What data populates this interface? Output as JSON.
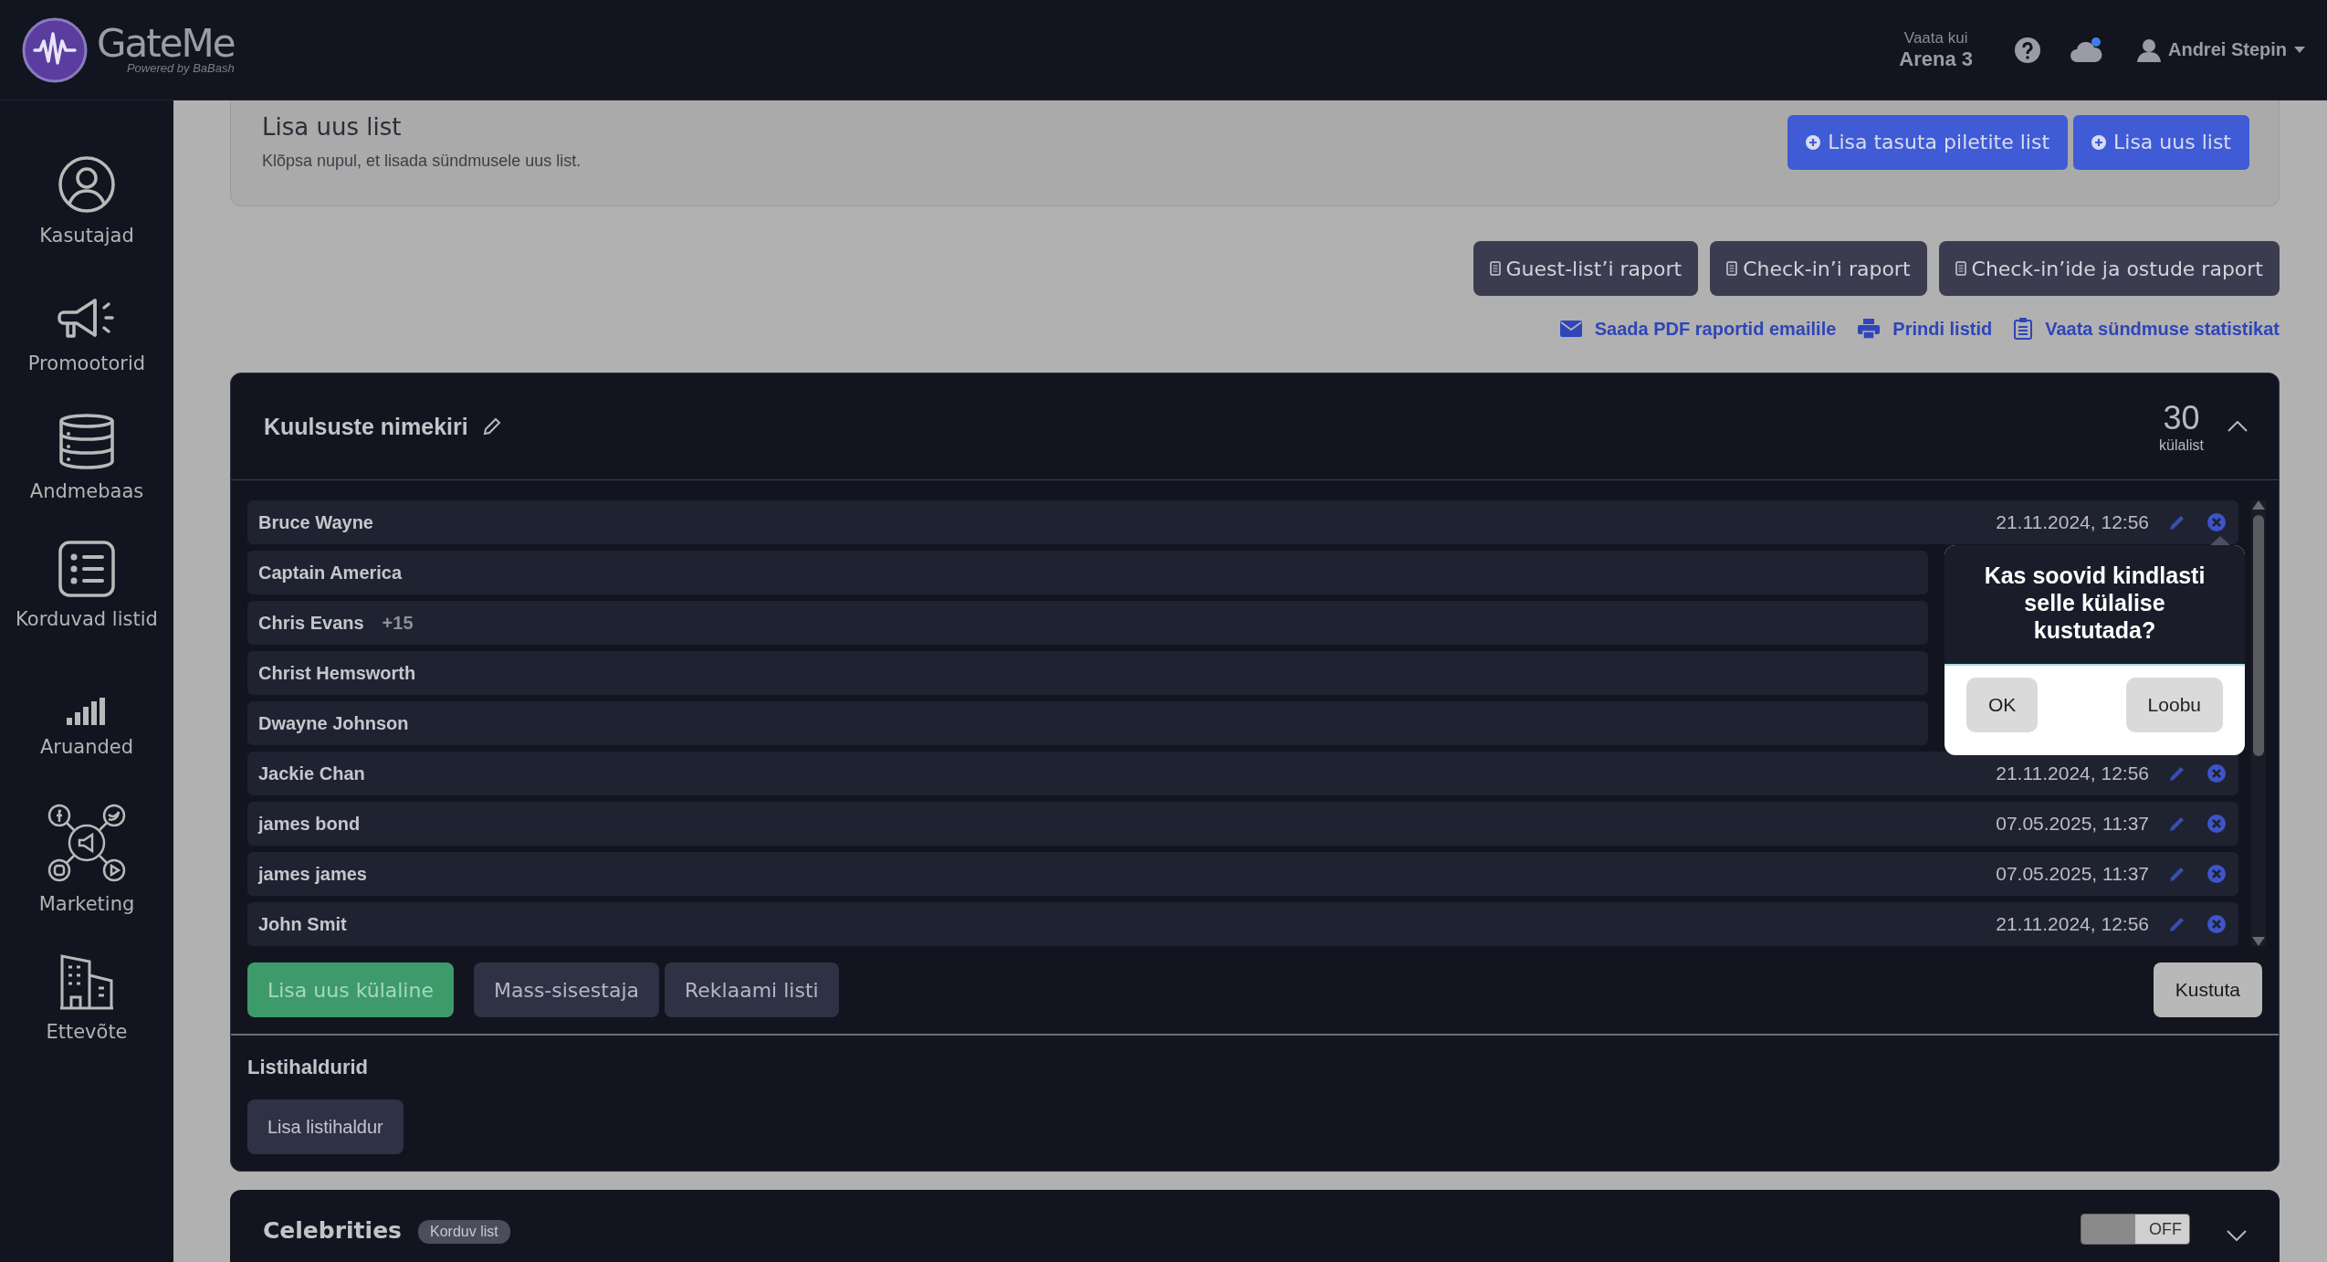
{
  "topbar": {
    "logo": "GateMe",
    "tagline": "Powered by BaBash",
    "view_as_label": "Vaata kui",
    "view_as_value": "Arena 3",
    "user": "Andrei Stepin"
  },
  "sidebar": {
    "items": [
      {
        "label": "Kasutajad",
        "kind": "user"
      },
      {
        "label": "Promootorid",
        "kind": "megaphone"
      },
      {
        "label": "Andmebaas",
        "kind": "database"
      },
      {
        "label": "Korduvad listid",
        "kind": "list"
      },
      {
        "label": "Aruanded",
        "kind": "bars"
      },
      {
        "label": "Marketing",
        "kind": "social"
      },
      {
        "label": "Ettevõte",
        "kind": "building"
      }
    ]
  },
  "add_list": {
    "title": "Lisa uus list",
    "description": "Klõpsa nupul, et lisada sündmusele uus list.",
    "buttons": [
      "Lisa tasuta piletite list",
      "Lisa uus list"
    ]
  },
  "report_buttons": [
    "Guest-list’i raport",
    "Check-in’i raport",
    "Check-in’ide ja ostude raport"
  ],
  "report_links": [
    {
      "label": "Saada PDF raportid emailile",
      "kind": "mail"
    },
    {
      "label": "Prindi listid",
      "kind": "print"
    },
    {
      "label": "Vaata sündmuse statistikat",
      "kind": "clipboard"
    }
  ],
  "guest_list": {
    "title": "Kuulsuste nimekiri",
    "count": "30",
    "count_label": "külalist",
    "guests": [
      {
        "name": "Bruce Wayne",
        "date": "21.11.2024, 12:56"
      },
      {
        "name": "Captain America"
      },
      {
        "name": "Chris Evans",
        "extra": "+15"
      },
      {
        "name": "Christ Hemsworth"
      },
      {
        "name": "Dwayne Johnson"
      },
      {
        "name": "Jackie Chan",
        "date": "21.11.2024, 12:56"
      },
      {
        "name": "james bond",
        "date": "07.05.2025, 11:37"
      },
      {
        "name": "james james",
        "date": "07.05.2025, 11:37"
      },
      {
        "name": "John Smit",
        "date": "21.11.2024, 12:56"
      }
    ],
    "buttons": [
      {
        "label": "Lisa uus külaline",
        "kind": "primary"
      },
      {
        "label": "Mass-sisestaja",
        "kind": "secondary"
      },
      {
        "label": "Reklaami listi",
        "kind": "secondary"
      }
    ],
    "delete_button": "Kustuta",
    "managers_title": "Listihaldurid",
    "add_manager_button": "Lisa listihaldur"
  },
  "confirm_popup": {
    "message": "Kas soovid kindlasti selle külalise kustutada?",
    "ok": "OK",
    "cancel": "Loobu"
  },
  "second_list": {
    "title": "Celebrities",
    "badge": "Korduv list",
    "toggle": {
      "label": "OFF",
      "on": false
    }
  }
}
